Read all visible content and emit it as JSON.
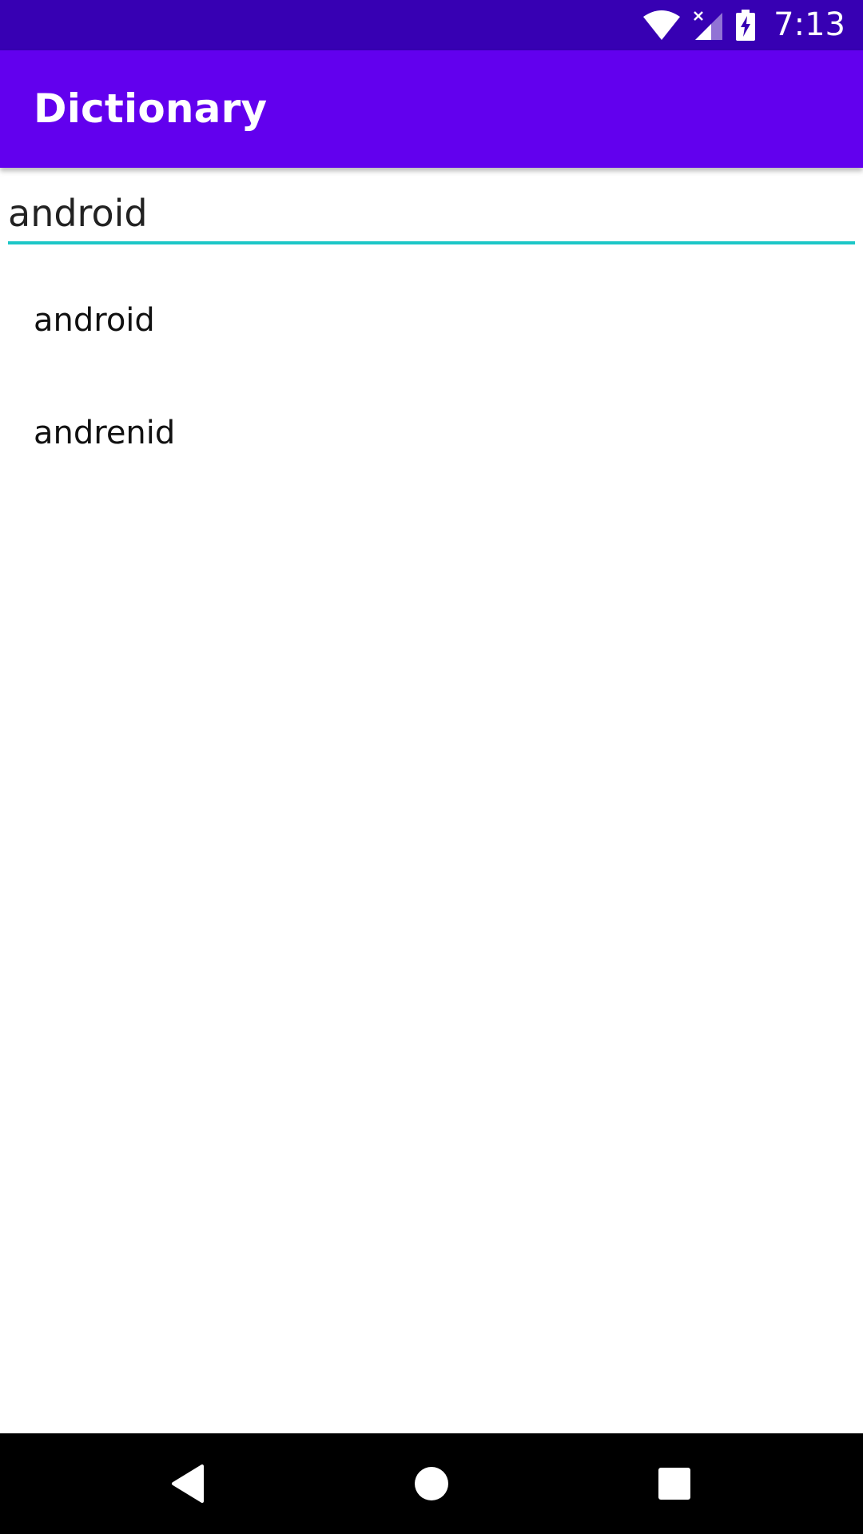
{
  "status_bar": {
    "time": "7:13",
    "icons": [
      "wifi-icon",
      "signal-no-sim-icon",
      "battery-charging-icon"
    ]
  },
  "app_bar": {
    "title": "Dictionary"
  },
  "search": {
    "value": "android"
  },
  "results": [
    {
      "word": "android"
    },
    {
      "word": "andrenid"
    }
  ],
  "navigation": {
    "buttons": [
      "back",
      "home",
      "recents"
    ]
  },
  "colors": {
    "status_bar": "#3700B3",
    "app_bar": "#6200EE",
    "input_underline": "#1CC7C7",
    "nav_bar": "#000000"
  }
}
